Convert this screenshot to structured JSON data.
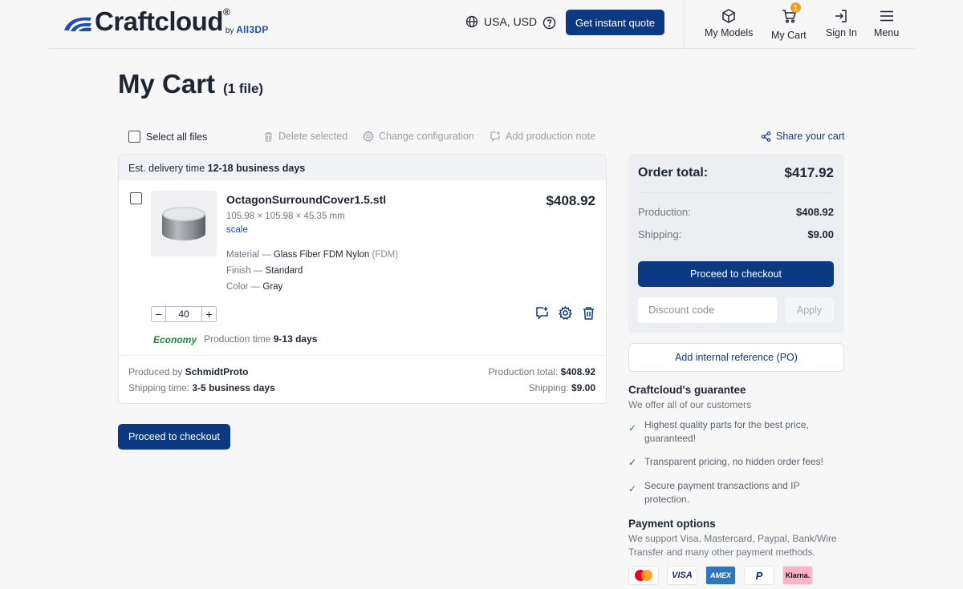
{
  "header": {
    "brand": "Craftcloud",
    "brand_reg": "®",
    "brand_by": "by",
    "brand_partner": "All3DP",
    "region": "USA, USD",
    "quote_button": "Get instant quote",
    "nav": {
      "models": "My Models",
      "cart": "My Cart",
      "cart_count": "1",
      "signin": "Sign In",
      "menu": "Menu"
    }
  },
  "page": {
    "title": "My Cart",
    "file_count": "(1 file)"
  },
  "toolbar": {
    "select_all": "Select all files",
    "delete": "Delete selected",
    "change_config": "Change configuration",
    "add_note": "Add production note",
    "share": "Share your cart"
  },
  "card": {
    "delivery_label": "Est. delivery time",
    "delivery_value": "12-18 business days",
    "item": {
      "name": "OctagonSurroundCover1.5.stl",
      "dims": "105.98 × 105.98 × 45.35 mm",
      "scale": "scale",
      "price": "$408.92",
      "material_label": "Material —",
      "material_value": "Glass Fiber FDM Nylon",
      "material_tech": "(FDM)",
      "finish_label": "Finish —",
      "finish_value": "Standard",
      "color_label": "Color —",
      "color_value": "Gray",
      "quantity": "40",
      "speed": "Economy",
      "production_label": "Production time",
      "production_value": "9-13 days"
    },
    "produced_label": "Produced by",
    "produced_value": "SchmidtProto",
    "shipping_time_label": "Shipping time:",
    "shipping_time_value": "3-5 business days",
    "production_total_label": "Production total:",
    "production_total_value": "$408.92",
    "shipping_label": "Shipping:",
    "shipping_value": "$9.00"
  },
  "checkout_button": "Proceed to checkout",
  "summary": {
    "title": "Order total:",
    "total": "$417.92",
    "production_label": "Production:",
    "production_value": "$408.92",
    "shipping_label": "Shipping:",
    "shipping_value": "$9.00",
    "checkout": "Proceed to checkout",
    "discount_placeholder": "Discount code",
    "apply": "Apply",
    "po_button": "Add internal reference (PO)"
  },
  "guarantee": {
    "title": "Craftcloud's guarantee",
    "subtitle": "We offer all of our customers",
    "items": [
      "Highest quality parts for the best price, guaranteed!",
      "Transparent pricing, no hidden order fees!",
      "Secure payment transactions and IP protection."
    ]
  },
  "payment": {
    "title": "Payment options",
    "text": "We support Visa, Mastercard, Paypal, Bank/Wire Transfer and many other payment methods.",
    "methods": [
      "mastercard",
      "VISA",
      "AMEX",
      "P",
      "Klarna."
    ]
  },
  "colors": {
    "primary": "#0b3a82",
    "economy": "#1f8a3a",
    "badge": "#f0a020",
    "background": "#f7f7f8"
  }
}
